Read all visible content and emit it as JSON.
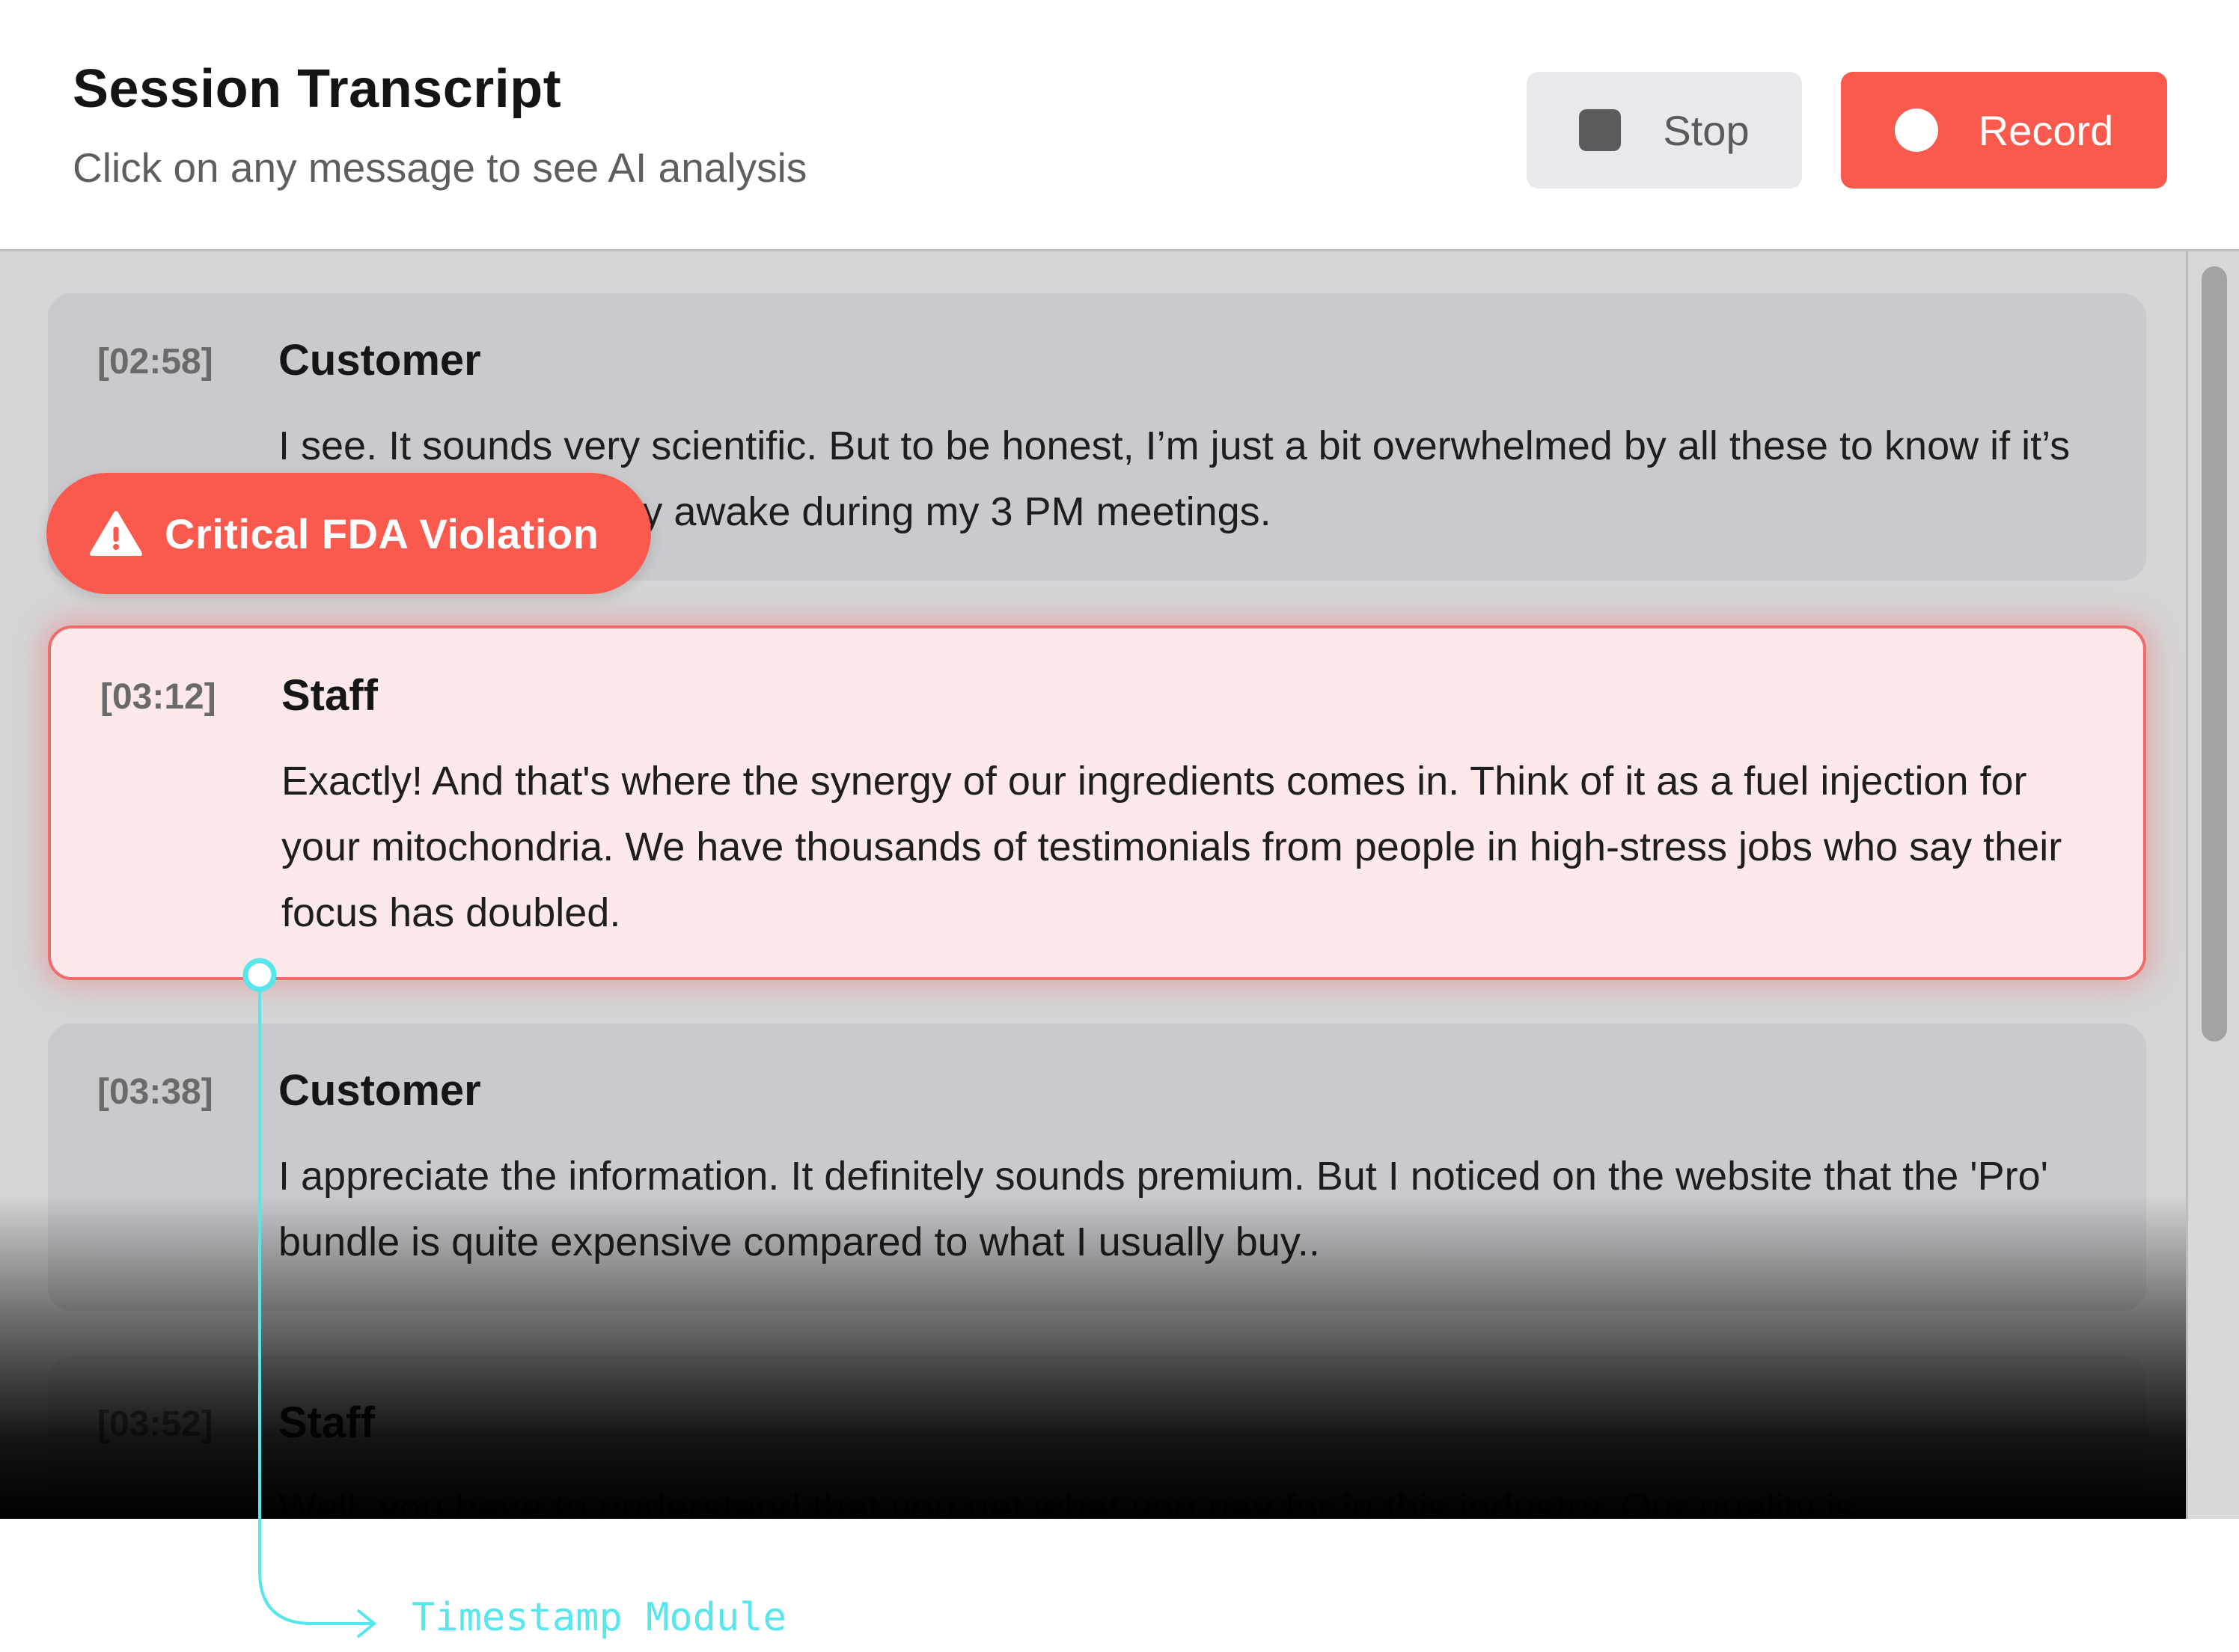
{
  "header": {
    "title": "Session Transcript",
    "subtitle": "Click on any message to see AI analysis",
    "stop_label": "Stop",
    "record_label": "Record"
  },
  "messages": [
    {
      "timestamp": "[02:58]",
      "speaker": "Customer",
      "text": "I see. It sounds very scientific. But to be honest, I’m just a bit overwhelmed by all these to know if it’s going to help me stay awake during my 3 PM meetings."
    },
    {
      "timestamp": "[03:12]",
      "speaker": "Staff",
      "text": "Exactly! And that's where the synergy of our ingredients comes in. Think of it as a fuel injection for your mitochondria. We have thousands of testimonials from people in high-stress jobs who say their focus has doubled."
    },
    {
      "timestamp": "[03:38]",
      "speaker": "Customer",
      "text": "I appreciate the information. It definitely sounds premium. But I noticed on the website that the 'Pro' bundle is quite expensive compared to what I usually buy.."
    },
    {
      "timestamp": "[03:52]",
      "speaker": "Staff",
      "text": "Well, you have to understand that you get what you pay for in this industry. Our quality is"
    }
  ],
  "badge": {
    "label": "Critical FDA Violation",
    "icon": "warning-triangle-icon"
  },
  "annotation": {
    "label": "Timestamp Module",
    "color": "#56e6ec"
  },
  "colors": {
    "accent": "#fa5a4e",
    "flagged_border": "#f26a6a",
    "flagged_bg": "#fde9ea"
  }
}
